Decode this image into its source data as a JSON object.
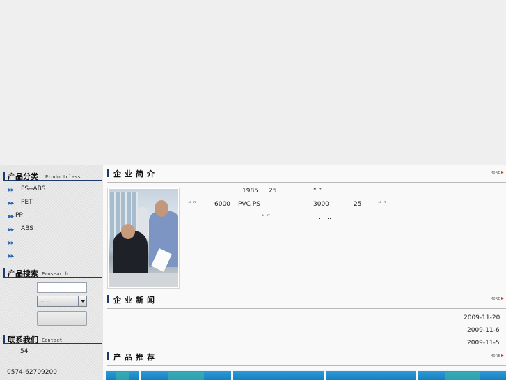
{
  "sidebar": {
    "product_class": {
      "title_cn": "产品分类",
      "title_en": "Productclass",
      "items": [
        {
          "label": "PS--ABS"
        },
        {
          "label": "PET"
        },
        {
          "label": "PP"
        },
        {
          "label": "ABS"
        },
        {
          "label": ""
        },
        {
          "label": ""
        }
      ]
    },
    "product_search": {
      "title_cn": "产品搜索",
      "title_en": "Prosearch",
      "select_value": "--  --"
    },
    "contact": {
      "title_cn": "联系我们",
      "title_en": "Contact",
      "line1": "54",
      "phone": "0574-62709200"
    }
  },
  "main": {
    "about": {
      "title": "企业简介",
      "more": "MORE",
      "fragments": {
        "year": "1985",
        "n25a": "25",
        "q1": "“  ”",
        "q2": "“  ”",
        "n6000": "6000",
        "pvcps": "PVC PS",
        "n3000": "3000",
        "n25b": "25",
        "q3": "“  ”",
        "q4": "“  ”",
        "ellipsis": "……"
      }
    },
    "news": {
      "title": "企业新闻",
      "more": "MORE",
      "dates": [
        "2009-11-20",
        "2009-11-6",
        "2009-11-5"
      ]
    },
    "products": {
      "title": "产品推荐",
      "more": "MORE"
    }
  }
}
